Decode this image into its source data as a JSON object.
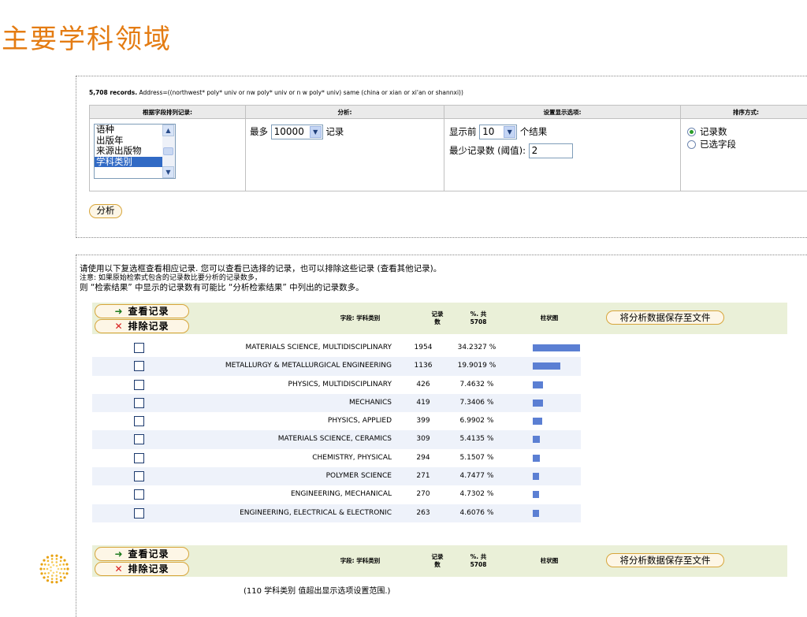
{
  "page_title": "主要学科领域",
  "query": {
    "count": "5,708 records.",
    "text": "Address=((northwest* poly* univ or nw poly* univ or n w poly* univ) same (china or xian or xi'an or shannxi))"
  },
  "settings": {
    "headers": {
      "field": "根据字段排列记录:",
      "analyze": "分析:",
      "display": "设置显示选项:",
      "sort": "排序方式:"
    },
    "field_options": [
      "语种",
      "出版年",
      "来源出版物",
      "学科类别"
    ],
    "selected_field_index": 3,
    "analyze": {
      "prefix": "最多",
      "value": "10000",
      "suffix": "记录"
    },
    "display": {
      "show_prefix": "显示前",
      "show_value": "10",
      "show_suffix": "个结果",
      "min_label": "最少记录数 (阈值):",
      "min_value": "2"
    },
    "sort": {
      "options": [
        "记录数",
        "已选字段"
      ],
      "selected_index": 0
    },
    "analyze_button": "分析"
  },
  "notes": {
    "line1": "请使用以下复选框查看相应记录. 您可以查看已选择的记录，也可以排除这些记录 (查看其他记录)。",
    "line2": "注意: 如果原始检索式包含的记录数比要分析的记录数多，",
    "line3": "则 “检索结果” 中显示的记录数有可能比 “分析检索结果” 中列出的记录数多。"
  },
  "results_header": {
    "view_button": "查看记录",
    "exclude_button": "排除记录",
    "field_label": "字段: 学科类别",
    "count_label_1": "记录",
    "count_label_2": "数",
    "pct_label_1": "%. 共",
    "pct_label_2": "5708",
    "chart_label": "柱状图",
    "save_button": "将分析数据保存至文件"
  },
  "rows": [
    {
      "category": "MATERIALS SCIENCE, MULTIDISCIPLINARY",
      "count": "1954",
      "count_value": 1954,
      "percent": "34.2327 %"
    },
    {
      "category": "METALLURGY & METALLURGICAL ENGINEERING",
      "count": "1136",
      "count_value": 1136,
      "percent": "19.9019 %"
    },
    {
      "category": "PHYSICS, MULTIDISCIPLINARY",
      "count": "426",
      "count_value": 426,
      "percent": "7.4632 %"
    },
    {
      "category": "MECHANICS",
      "count": "419",
      "count_value": 419,
      "percent": "7.3406 %"
    },
    {
      "category": "PHYSICS, APPLIED",
      "count": "399",
      "count_value": 399,
      "percent": "6.9902 %"
    },
    {
      "category": "MATERIALS SCIENCE, CERAMICS",
      "count": "309",
      "count_value": 309,
      "percent": "5.4135 %"
    },
    {
      "category": "CHEMISTRY, PHYSICAL",
      "count": "294",
      "count_value": 294,
      "percent": "5.1507 %"
    },
    {
      "category": "POLYMER SCIENCE",
      "count": "271",
      "count_value": 271,
      "percent": "4.7477 %"
    },
    {
      "category": "ENGINEERING, MECHANICAL",
      "count": "270",
      "count_value": 270,
      "percent": "4.7302 %"
    },
    {
      "category": "ENGINEERING, ELECTRICAL & ELECTRONIC",
      "count": "263",
      "count_value": 263,
      "percent": "4.6076 %"
    }
  ],
  "footer_note": "(110 学科类别 值超出显示选项设置范围.)",
  "colors": {
    "title": "#e47c13",
    "bar": "#5b7fd3",
    "header_bg": "#eaf0d8",
    "row_alt": "#eef2fa",
    "button_border": "#d7a53a"
  },
  "icons": {
    "view": "arrow-right-icon",
    "exclude": "cross-icon",
    "logo": "dotted-circle-logo"
  }
}
